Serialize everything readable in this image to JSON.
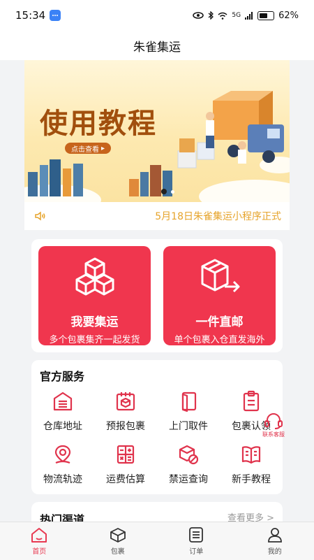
{
  "status": {
    "time": "15:34",
    "battery": "62%",
    "network": "5G"
  },
  "header": {
    "title": "朱雀集运"
  },
  "banner": {
    "title": "使用教程",
    "button": "点击查看"
  },
  "notice": {
    "text": "5月18日朱雀集运小程序正式"
  },
  "hero": [
    {
      "title": "我要集运",
      "subtitle": "多个包裹集齐一起发货",
      "icon": "boxes-icon"
    },
    {
      "title": "一件直邮",
      "subtitle": "单个包裹入仓直发海外",
      "icon": "box-arrow-icon"
    }
  ],
  "services": {
    "title": "官方服务",
    "items": [
      {
        "label": "仓库地址",
        "icon": "warehouse-icon"
      },
      {
        "label": "预报包裹",
        "icon": "calendar-box-icon"
      },
      {
        "label": "上门取件",
        "icon": "door-icon"
      },
      {
        "label": "包裹认领",
        "icon": "clipboard-icon"
      },
      {
        "label": "物流轨迹",
        "icon": "location-pin-icon"
      },
      {
        "label": "运费估算",
        "icon": "calculator-icon"
      },
      {
        "label": "禁运查询",
        "icon": "forbidden-box-icon"
      },
      {
        "label": "新手教程",
        "icon": "book-icon"
      }
    ]
  },
  "support": {
    "label": "联系客服"
  },
  "hot": {
    "title": "热门渠道",
    "more": "查看更多 >"
  },
  "tabs": [
    {
      "label": "首页",
      "icon": "home-icon",
      "active": true
    },
    {
      "label": "包裹",
      "icon": "package-icon",
      "active": false
    },
    {
      "label": "订单",
      "icon": "order-icon",
      "active": false
    },
    {
      "label": "我的",
      "icon": "user-icon",
      "active": false
    }
  ],
  "colors": {
    "accent": "#f0364e",
    "notice": "#e6a32a",
    "tab_active": "#e83a52"
  }
}
